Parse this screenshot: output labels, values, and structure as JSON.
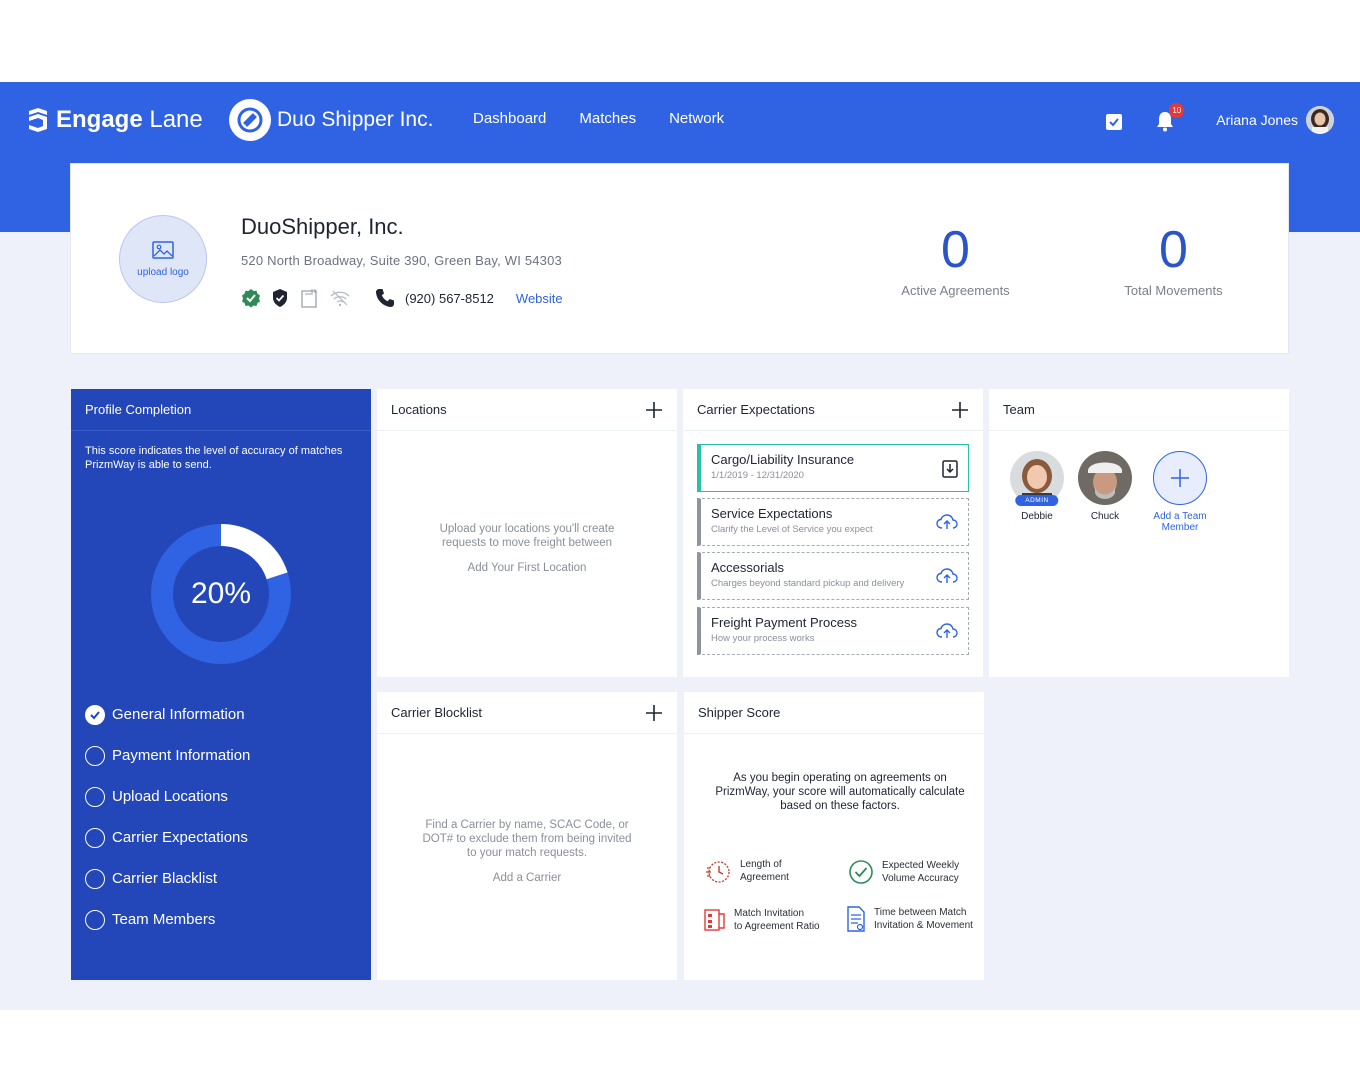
{
  "nav": {
    "brand_bold": "Engage",
    "brand_light": " Lane",
    "company": "Duo Shipper Inc.",
    "links": [
      "Dashboard",
      "Matches",
      "Network"
    ],
    "notifications_count": "10",
    "user_name": "Ariana Jones"
  },
  "profile": {
    "upload_logo": "upload logo",
    "name": "DuoShipper, Inc.",
    "address": "520 North Broadway, Suite 390, Green Bay, WI 54303",
    "phone": "(920) 567-8512",
    "website": "Website",
    "active_agreements_value": "0",
    "active_agreements_label": "Active Agreements",
    "total_movements_value": "0",
    "total_movements_label": "Total Movements"
  },
  "completion": {
    "title": "Profile Completion",
    "description": "This score indicates the level of accuracy of matches PrizmWay is able to send.",
    "percent_label": "20%",
    "percent": 20,
    "steps": [
      {
        "label": "General Information",
        "done": true
      },
      {
        "label": "Payment Information",
        "done": false
      },
      {
        "label": "Upload Locations",
        "done": false
      },
      {
        "label": "Carrier Expectations",
        "done": false
      },
      {
        "label": "Carrier Blacklist",
        "done": false
      },
      {
        "label": "Team Members",
        "done": false
      }
    ]
  },
  "locations": {
    "title": "Locations",
    "empty_line1": "Upload your locations you'll create",
    "empty_line2": "requests to move freight between",
    "cta": "Add Your First Location"
  },
  "expectations": {
    "title": "Carrier Expectations",
    "items": [
      {
        "title": "Cargo/Liability Insurance",
        "subtitle": "1/1/2019 - 12/31/2020"
      },
      {
        "title": "Service Expectations",
        "subtitle": "Clarify the Level of Service you expect"
      },
      {
        "title": "Accessorials",
        "subtitle": "Charges beyond standard pickup and delivery"
      },
      {
        "title": "Freight Payment Process",
        "subtitle": "How your process works"
      }
    ]
  },
  "team": {
    "title": "Team",
    "members": [
      {
        "name": "Debbie",
        "badge": "ADMIN"
      },
      {
        "name": "Chuck"
      }
    ],
    "add_line1": "Add a Team",
    "add_line2": "Member"
  },
  "blocklist": {
    "title": "Carrier Blocklist",
    "empty_line1": "Find a Carrier by name, SCAC Code, or",
    "empty_line2": "DOT# to exclude them from being invited",
    "empty_line3": "to your match requests.",
    "cta": "Add a Carrier"
  },
  "score": {
    "title": "Shipper Score",
    "desc_line1": "As you begin operating on agreements on",
    "desc_line2": "PrizmWay, your score will automatically calculate",
    "desc_line3": "based on these factors.",
    "factors": [
      {
        "line1": "Length of",
        "line2": "Agreement"
      },
      {
        "line1": "Expected Weekly",
        "line2": "Volume Accuracy"
      },
      {
        "line1": "Match Invitation",
        "line2": "to Agreement Ratio"
      },
      {
        "line1": "Time between Match",
        "line2": "Invitation & Movement"
      }
    ]
  },
  "colors": {
    "brand_blue": "#2f63e3",
    "panel_blue": "#2347b8",
    "accent_teal": "#28c0a6",
    "stat_blue": "#2a54c8"
  }
}
